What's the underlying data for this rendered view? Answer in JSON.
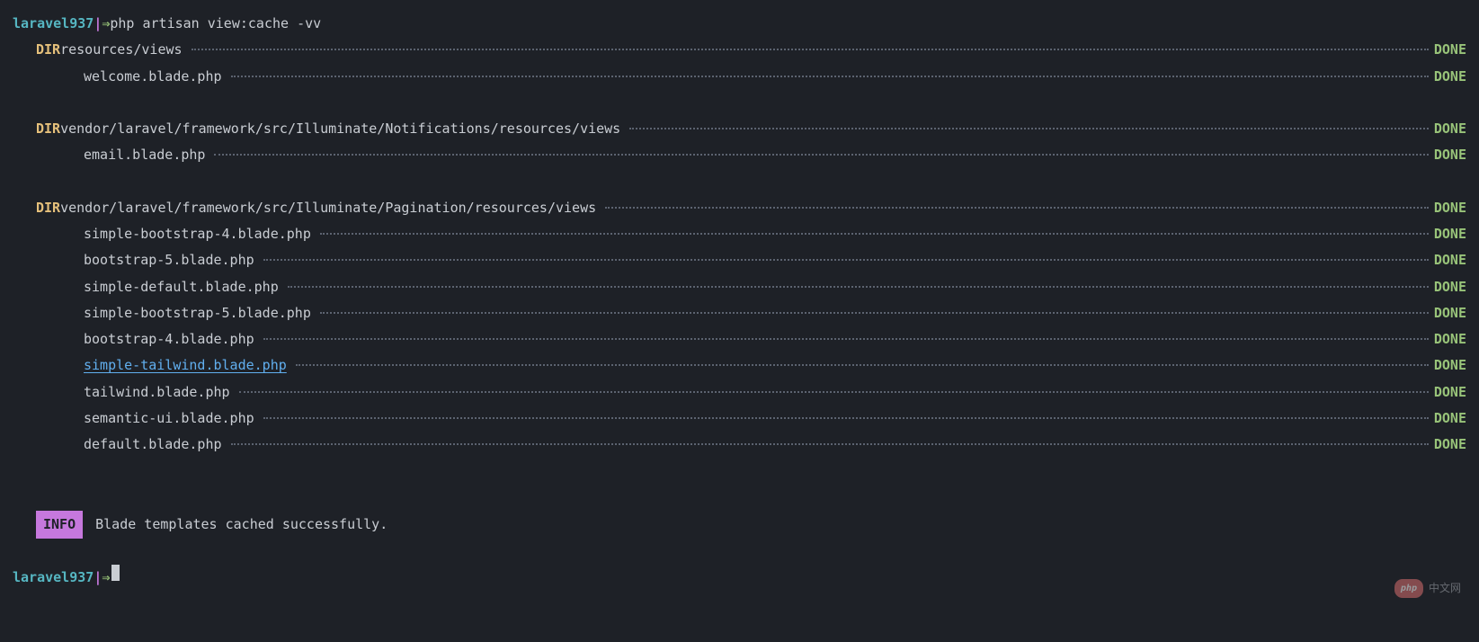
{
  "prompt": {
    "host": "laravel937",
    "sep": "|",
    "arrow": "⇒",
    "command": "php artisan view:cache -vv"
  },
  "dir_label": "DIR",
  "status_done": "DONE",
  "groups": [
    {
      "path": "resources/views",
      "files": [
        {
          "name": "welcome.blade.php",
          "link": false
        }
      ]
    },
    {
      "path": "vendor/laravel/framework/src/Illuminate/Notifications/resources/views",
      "files": [
        {
          "name": "email.blade.php",
          "link": false
        }
      ]
    },
    {
      "path": "vendor/laravel/framework/src/Illuminate/Pagination/resources/views",
      "files": [
        {
          "name": "simple-bootstrap-4.blade.php",
          "link": false
        },
        {
          "name": "bootstrap-5.blade.php",
          "link": false
        },
        {
          "name": "simple-default.blade.php",
          "link": false
        },
        {
          "name": "simple-bootstrap-5.blade.php",
          "link": false
        },
        {
          "name": "bootstrap-4.blade.php",
          "link": false
        },
        {
          "name": "simple-tailwind.blade.php",
          "link": true
        },
        {
          "name": "tailwind.blade.php",
          "link": false
        },
        {
          "name": "semantic-ui.blade.php",
          "link": false
        },
        {
          "name": "default.blade.php",
          "link": false
        }
      ]
    }
  ],
  "info": {
    "badge": "INFO",
    "message": "Blade templates cached successfully."
  },
  "watermark": {
    "pill": "php",
    "text": "中文网"
  }
}
